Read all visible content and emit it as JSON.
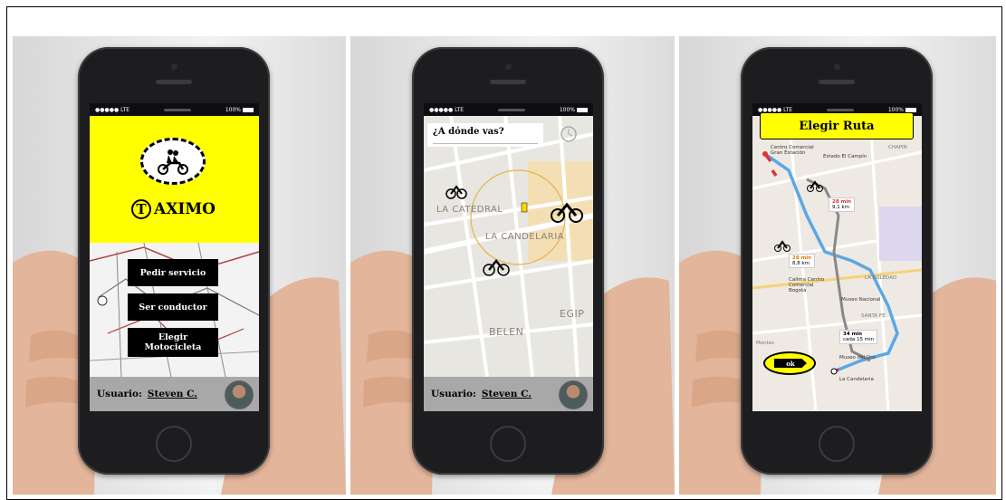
{
  "status_bar": {
    "carrier": "●●●●● LTE",
    "battery": "100%"
  },
  "screen1": {
    "brand_letter": "T",
    "brand_rest": "AXIMO",
    "buttons": [
      "Pedir servicio",
      "Ser conductor",
      "Elegir Motocicleta"
    ],
    "user_label": "Usuario:",
    "user_name": "Steven C."
  },
  "screen2": {
    "search_prompt": "¿A dónde vas?",
    "map_labels": {
      "catedral": "LA CATEDRAL",
      "candelaria": "LA CANDELARIA",
      "belen": "BELEN",
      "egip": "EGIP"
    },
    "user_label": "Usuario:",
    "user_name": "Steven C."
  },
  "screen3": {
    "title": "Elegir Ruta",
    "ok_label": "ok",
    "map_labels": {
      "centro": "Centro Comercial Gran Estación",
      "estadio": "Estado El Campín",
      "calima": "Calima Centro Comercial Bogotá",
      "museo_nacional": "Museo Nacional",
      "museo_oro": "Museo del Oro",
      "candelaria": "La Candelaria",
      "chapin": "CHAPIN",
      "santa_fe": "SANTA FE",
      "la_soledad": "LA SOLEDAD",
      "montes": "Montes"
    },
    "route_options": [
      {
        "time": "28 min",
        "dist": "9,1 km"
      },
      {
        "time": "28 min",
        "dist": "8,8 km"
      },
      {
        "time": "34 min",
        "dist": "cada 15 min"
      }
    ]
  }
}
